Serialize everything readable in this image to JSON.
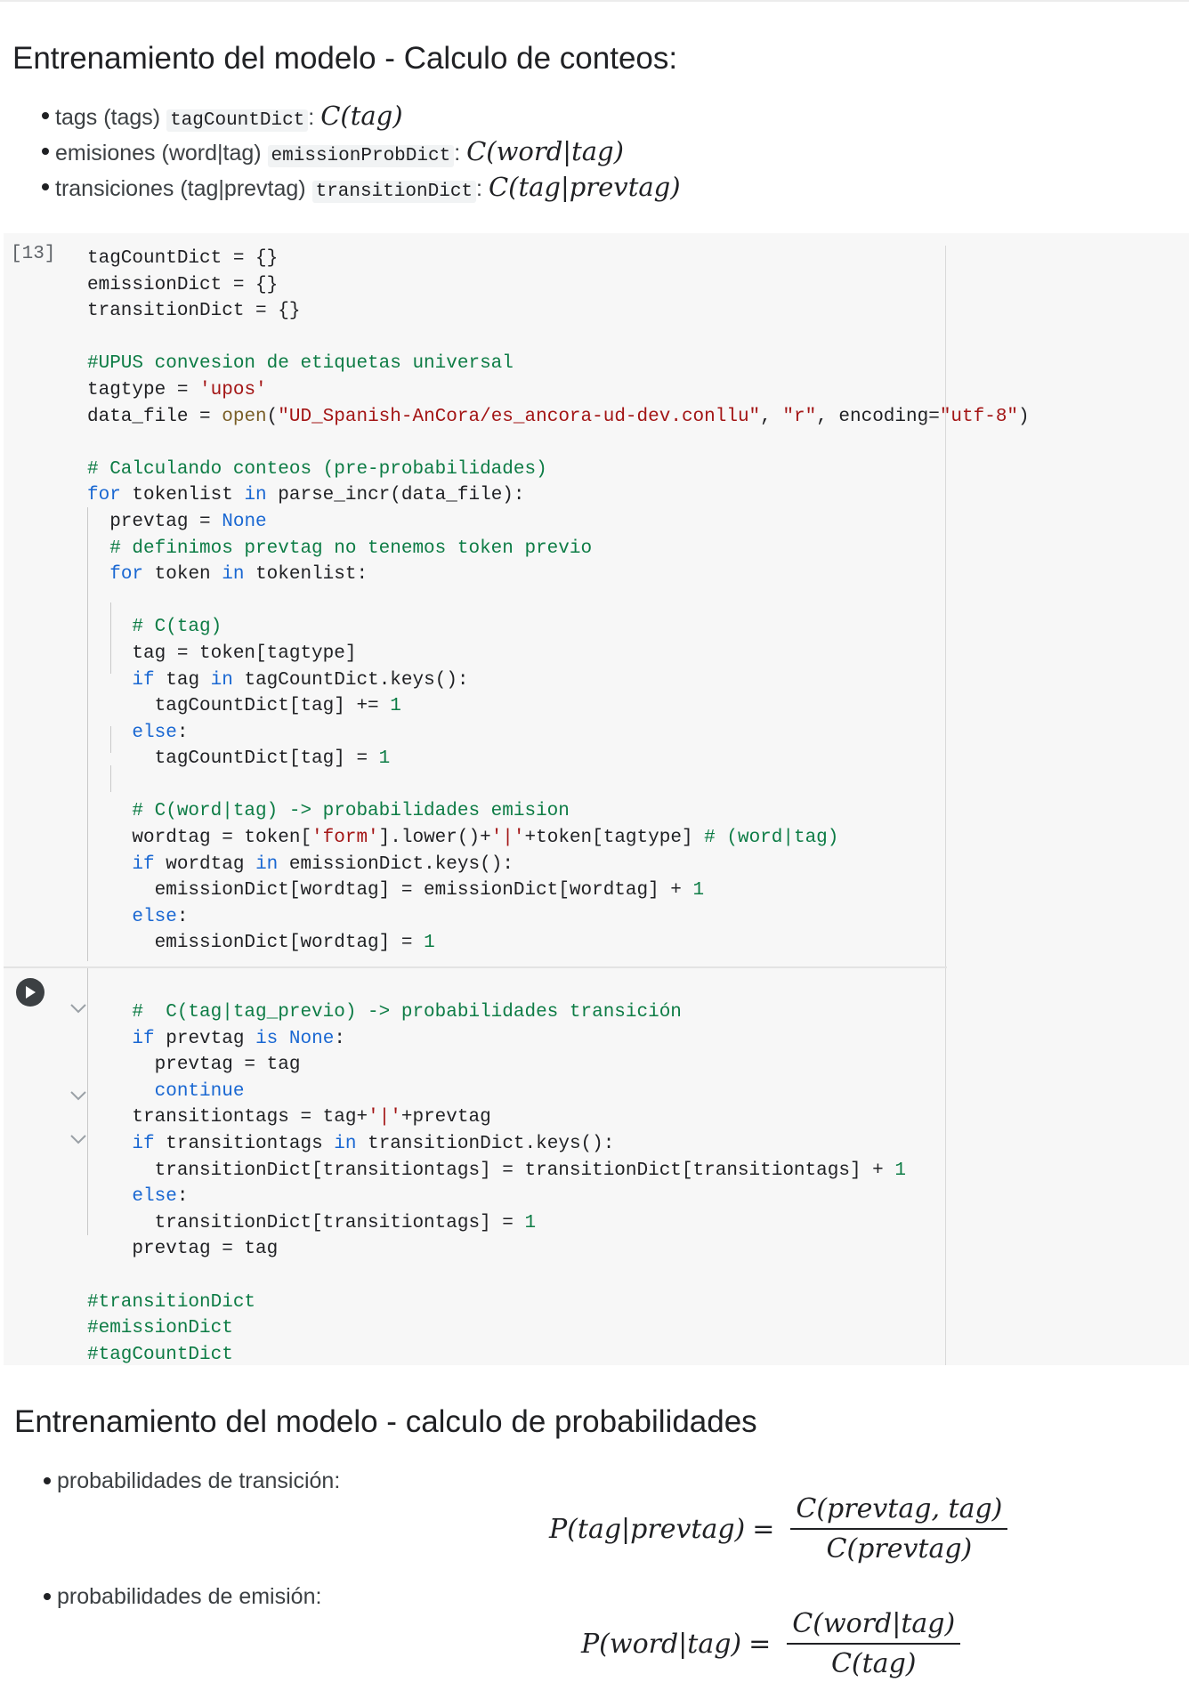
{
  "section1": {
    "title": "Entrenamiento del modelo - Calculo de conteos:",
    "bullets": [
      {
        "text": "tags (tags)",
        "code": "tagCountDict",
        "colon": ":",
        "math": "C(tag)"
      },
      {
        "text": "emisiones (word|tag)",
        "code": "emissionProbDict",
        "colon": ":",
        "math": "C(word|tag)"
      },
      {
        "text": "transiciones (tag|prevtag)",
        "code": "transitionDict",
        "colon": ":",
        "math": "C(tag|prevtag)"
      }
    ]
  },
  "cell": {
    "execution_count": "[13]"
  },
  "section2": {
    "title": "Entrenamiento del modelo - calculo de probabilidades",
    "bullets": [
      {
        "text": "probabilidades de transición:"
      },
      {
        "text": "probabilidades de emisión:"
      }
    ],
    "formula1": {
      "lhs": "P(tag|prevtag)",
      "eq": "=",
      "numerator": "C(prevtag, tag)",
      "denominator": "C(prevtag)"
    },
    "formula2": {
      "lhs": "P(word|tag)",
      "eq": "=",
      "numerator": "C(word|tag)",
      "denominator": "C(tag)"
    }
  },
  "colors": {
    "keyword": "#1967d2",
    "comment": "#0d7c45",
    "string": "#a31515",
    "cell_bg": "#f7f7f7"
  },
  "icons": {
    "run": "play-circle-icon",
    "collapse": "chevron-down-icon"
  }
}
